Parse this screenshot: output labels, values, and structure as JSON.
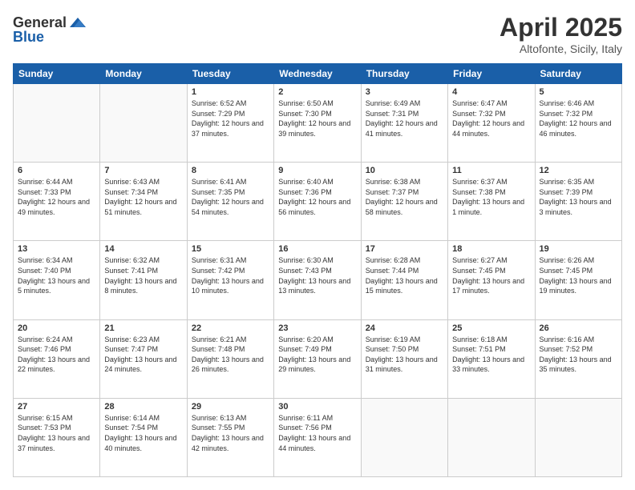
{
  "header": {
    "logo_general": "General",
    "logo_blue": "Blue",
    "month_title": "April 2025",
    "location": "Altofonte, Sicily, Italy"
  },
  "weekdays": [
    "Sunday",
    "Monday",
    "Tuesday",
    "Wednesday",
    "Thursday",
    "Friday",
    "Saturday"
  ],
  "weeks": [
    [
      {
        "day": "",
        "info": ""
      },
      {
        "day": "",
        "info": ""
      },
      {
        "day": "1",
        "info": "Sunrise: 6:52 AM\nSunset: 7:29 PM\nDaylight: 12 hours and 37 minutes."
      },
      {
        "day": "2",
        "info": "Sunrise: 6:50 AM\nSunset: 7:30 PM\nDaylight: 12 hours and 39 minutes."
      },
      {
        "day": "3",
        "info": "Sunrise: 6:49 AM\nSunset: 7:31 PM\nDaylight: 12 hours and 41 minutes."
      },
      {
        "day": "4",
        "info": "Sunrise: 6:47 AM\nSunset: 7:32 PM\nDaylight: 12 hours and 44 minutes."
      },
      {
        "day": "5",
        "info": "Sunrise: 6:46 AM\nSunset: 7:32 PM\nDaylight: 12 hours and 46 minutes."
      }
    ],
    [
      {
        "day": "6",
        "info": "Sunrise: 6:44 AM\nSunset: 7:33 PM\nDaylight: 12 hours and 49 minutes."
      },
      {
        "day": "7",
        "info": "Sunrise: 6:43 AM\nSunset: 7:34 PM\nDaylight: 12 hours and 51 minutes."
      },
      {
        "day": "8",
        "info": "Sunrise: 6:41 AM\nSunset: 7:35 PM\nDaylight: 12 hours and 54 minutes."
      },
      {
        "day": "9",
        "info": "Sunrise: 6:40 AM\nSunset: 7:36 PM\nDaylight: 12 hours and 56 minutes."
      },
      {
        "day": "10",
        "info": "Sunrise: 6:38 AM\nSunset: 7:37 PM\nDaylight: 12 hours and 58 minutes."
      },
      {
        "day": "11",
        "info": "Sunrise: 6:37 AM\nSunset: 7:38 PM\nDaylight: 13 hours and 1 minute."
      },
      {
        "day": "12",
        "info": "Sunrise: 6:35 AM\nSunset: 7:39 PM\nDaylight: 13 hours and 3 minutes."
      }
    ],
    [
      {
        "day": "13",
        "info": "Sunrise: 6:34 AM\nSunset: 7:40 PM\nDaylight: 13 hours and 5 minutes."
      },
      {
        "day": "14",
        "info": "Sunrise: 6:32 AM\nSunset: 7:41 PM\nDaylight: 13 hours and 8 minutes."
      },
      {
        "day": "15",
        "info": "Sunrise: 6:31 AM\nSunset: 7:42 PM\nDaylight: 13 hours and 10 minutes."
      },
      {
        "day": "16",
        "info": "Sunrise: 6:30 AM\nSunset: 7:43 PM\nDaylight: 13 hours and 13 minutes."
      },
      {
        "day": "17",
        "info": "Sunrise: 6:28 AM\nSunset: 7:44 PM\nDaylight: 13 hours and 15 minutes."
      },
      {
        "day": "18",
        "info": "Sunrise: 6:27 AM\nSunset: 7:45 PM\nDaylight: 13 hours and 17 minutes."
      },
      {
        "day": "19",
        "info": "Sunrise: 6:26 AM\nSunset: 7:45 PM\nDaylight: 13 hours and 19 minutes."
      }
    ],
    [
      {
        "day": "20",
        "info": "Sunrise: 6:24 AM\nSunset: 7:46 PM\nDaylight: 13 hours and 22 minutes."
      },
      {
        "day": "21",
        "info": "Sunrise: 6:23 AM\nSunset: 7:47 PM\nDaylight: 13 hours and 24 minutes."
      },
      {
        "day": "22",
        "info": "Sunrise: 6:21 AM\nSunset: 7:48 PM\nDaylight: 13 hours and 26 minutes."
      },
      {
        "day": "23",
        "info": "Sunrise: 6:20 AM\nSunset: 7:49 PM\nDaylight: 13 hours and 29 minutes."
      },
      {
        "day": "24",
        "info": "Sunrise: 6:19 AM\nSunset: 7:50 PM\nDaylight: 13 hours and 31 minutes."
      },
      {
        "day": "25",
        "info": "Sunrise: 6:18 AM\nSunset: 7:51 PM\nDaylight: 13 hours and 33 minutes."
      },
      {
        "day": "26",
        "info": "Sunrise: 6:16 AM\nSunset: 7:52 PM\nDaylight: 13 hours and 35 minutes."
      }
    ],
    [
      {
        "day": "27",
        "info": "Sunrise: 6:15 AM\nSunset: 7:53 PM\nDaylight: 13 hours and 37 minutes."
      },
      {
        "day": "28",
        "info": "Sunrise: 6:14 AM\nSunset: 7:54 PM\nDaylight: 13 hours and 40 minutes."
      },
      {
        "day": "29",
        "info": "Sunrise: 6:13 AM\nSunset: 7:55 PM\nDaylight: 13 hours and 42 minutes."
      },
      {
        "day": "30",
        "info": "Sunrise: 6:11 AM\nSunset: 7:56 PM\nDaylight: 13 hours and 44 minutes."
      },
      {
        "day": "",
        "info": ""
      },
      {
        "day": "",
        "info": ""
      },
      {
        "day": "",
        "info": ""
      }
    ]
  ]
}
